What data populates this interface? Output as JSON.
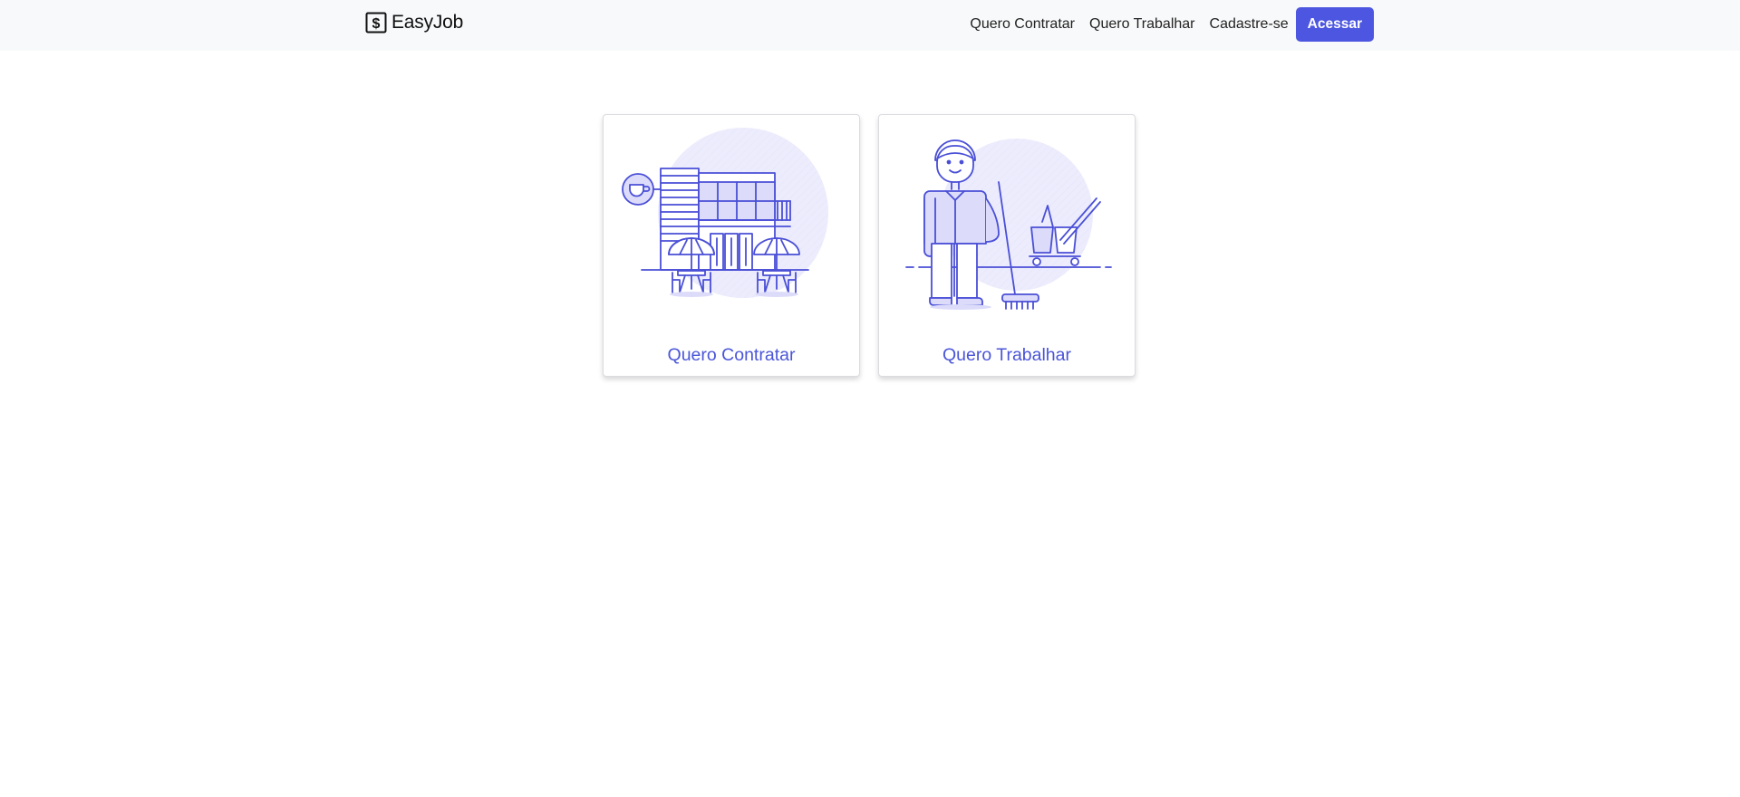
{
  "navbar": {
    "brand": "EasyJob",
    "brand_icon": "dollar-sign-icon",
    "links": [
      "Quero Contratar",
      "Quero Trabalhar",
      "Cadastre-se"
    ],
    "login_button": "Acessar"
  },
  "cards": [
    {
      "title": "Quero Contratar",
      "illustration": "cafe-building-illustration"
    },
    {
      "title": "Quero Trabalhar",
      "illustration": "cleaning-worker-illustration"
    }
  ],
  "colors": {
    "accent": "#4d56e0",
    "illustration_stroke": "#4a4fd6",
    "illustration_fill": "#dcdcfa",
    "navbar_bg": "#f8f9fa"
  }
}
